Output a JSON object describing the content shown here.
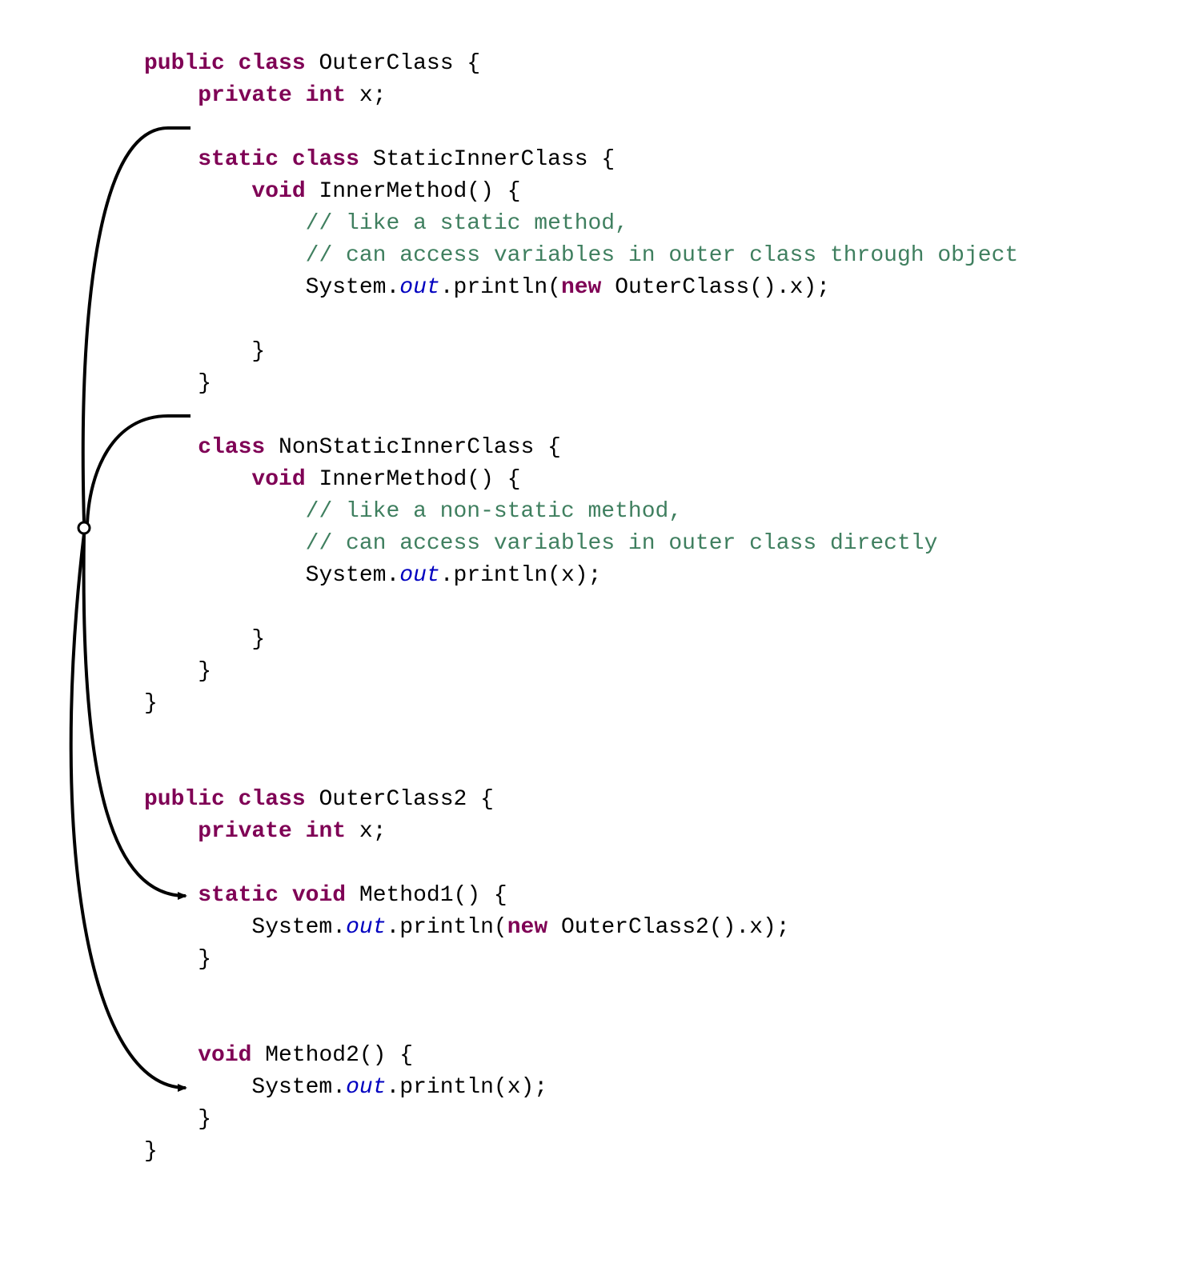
{
  "kw": {
    "public": "public",
    "class": "class",
    "private": "private",
    "int": "int",
    "static": "static",
    "void": "void",
    "new": "new"
  },
  "id": {
    "OuterClass": "OuterClass",
    "x": "x",
    "StaticInnerClass": "StaticInnerClass",
    "InnerMethod": "InnerMethod",
    "System": "System",
    "out": "out",
    "println": "println",
    "NonStaticInnerClass": "NonStaticInnerClass",
    "OuterClass2": "OuterClass2",
    "Method1": "Method1",
    "Method2": "Method2"
  },
  "cm": {
    "c1": "// like a static method,",
    "c2": "// can access variables in outer class through object",
    "c3": "// like a non-static method,",
    "c4": "// can access variables in outer class directly"
  },
  "diagram": {
    "description": "Arrows connect inner-class definitions in OuterClass to corresponding method definitions in OuterClass2",
    "arrows": [
      {
        "from": "StaticInnerClass",
        "to": "Method1"
      },
      {
        "from": "NonStaticInnerClass",
        "to": "Method2"
      }
    ]
  }
}
